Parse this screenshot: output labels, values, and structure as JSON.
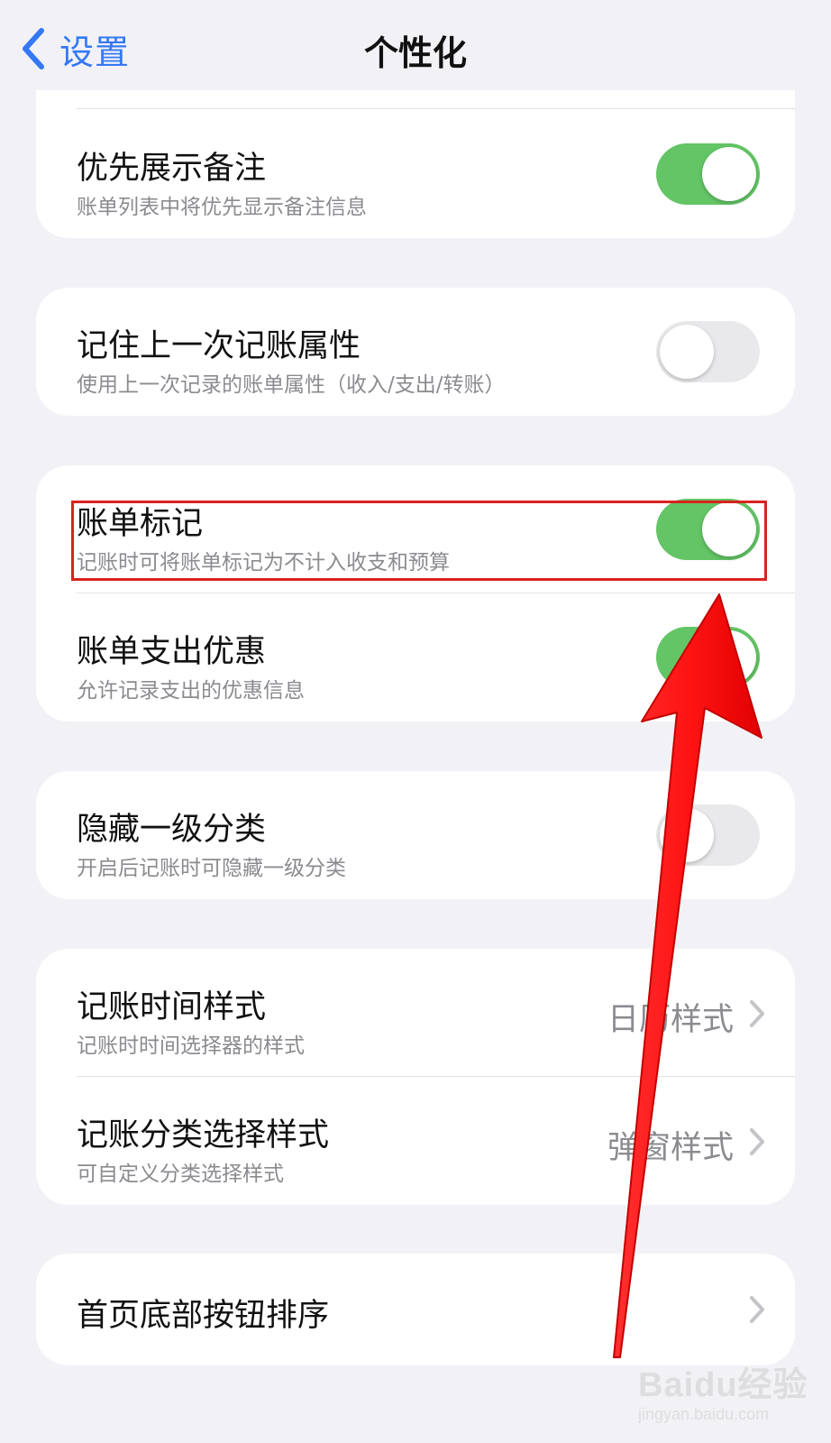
{
  "nav": {
    "back_label": "设置",
    "title": "个性化"
  },
  "settings": {
    "show_note_first": {
      "title": "优先展示备注",
      "subtitle": "账单列表中将优先显示备注信息",
      "enabled": true
    },
    "remember_last_attr": {
      "title": "记住上一次记账属性",
      "subtitle": "使用上一次记录的账单属性（收入/支出/转账）",
      "enabled": false
    },
    "bill_mark": {
      "title": "账单标记",
      "subtitle": "记账时可将账单标记为不计入收支和预算",
      "enabled": true
    },
    "expense_discount": {
      "title": "账单支出优惠",
      "subtitle": "允许记录支出的优惠信息",
      "enabled": true
    },
    "hide_primary_category": {
      "title": "隐藏一级分类",
      "subtitle": "开启后记账时可隐藏一级分类",
      "enabled": false
    },
    "time_style": {
      "title": "记账时间样式",
      "subtitle": "记账时时间选择器的样式",
      "value": "日历样式"
    },
    "category_select_style": {
      "title": "记账分类选择样式",
      "subtitle": "可自定义分类选择样式",
      "value": "弹窗样式"
    },
    "bottom_button_order": {
      "title": "首页底部按钮排序"
    }
  },
  "watermark": {
    "logo": "Baidu经验",
    "url": "jingyan.baidu.com"
  },
  "colors": {
    "accent": "#3478f6",
    "toggle_on": "#63c565",
    "toggle_off": "#e9e9eb",
    "highlight": "#d9231f",
    "arrow": "#ff1a1a"
  }
}
